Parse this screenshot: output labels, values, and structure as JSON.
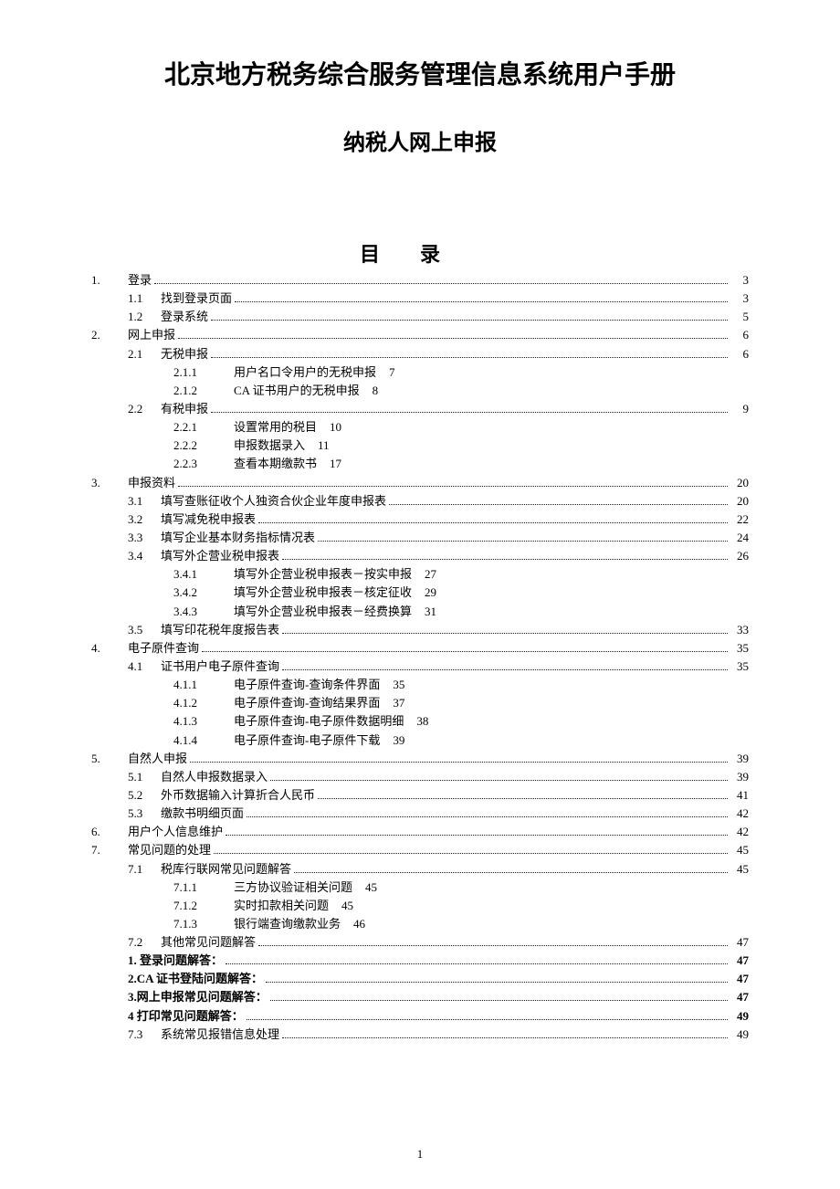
{
  "title": "北京地方税务综合服务管理信息系统用户手册",
  "subtitle": "纳税人网上申报",
  "toc_heading": "目录",
  "page_number": "1",
  "entries": [
    {
      "l": "l1",
      "num": "1.",
      "label": "登录",
      "page": "3",
      "dots": true
    },
    {
      "l": "l2",
      "num": "1.1",
      "label": "找到登录页面",
      "page": "3",
      "dots": true
    },
    {
      "l": "l2",
      "num": "1.2",
      "label": "登录系统",
      "page": "5",
      "dots": true
    },
    {
      "l": "l1",
      "num": "2.",
      "label": "网上申报",
      "page": "6",
      "dots": true
    },
    {
      "l": "l2",
      "num": "2.1",
      "label": "无税申报",
      "page": "6",
      "dots": true
    },
    {
      "l": "l3",
      "num": "2.1.1",
      "label": "用户名口令用户的无税申报",
      "page": "7",
      "dots": false
    },
    {
      "l": "l3",
      "num": "2.1.2",
      "label": "CA 证书用户的无税申报",
      "page": "8",
      "dots": false
    },
    {
      "l": "l2",
      "num": "2.2",
      "label": "有税申报",
      "page": "9",
      "dots": true
    },
    {
      "l": "l3",
      "num": "2.2.1",
      "label": "设置常用的税目",
      "page": "10",
      "dots": false
    },
    {
      "l": "l3",
      "num": "2.2.2",
      "label": "申报数据录入",
      "page": "11",
      "dots": false
    },
    {
      "l": "l3",
      "num": "2.2.3",
      "label": "查看本期缴款书",
      "page": "17",
      "dots": false
    },
    {
      "l": "l1",
      "num": "3.",
      "label": "申报资料",
      "page": "20",
      "dots": true
    },
    {
      "l": "l2",
      "num": "3.1",
      "label": "填写查账征收个人独资合伙企业年度申报表",
      "page": "20",
      "dots": true
    },
    {
      "l": "l2",
      "num": "3.2",
      "label": "填写减免税申报表",
      "page": "22",
      "dots": true
    },
    {
      "l": "l2",
      "num": "3.3",
      "label": "填写企业基本财务指标情况表",
      "page": "24",
      "dots": true
    },
    {
      "l": "l2",
      "num": "3.4",
      "label": "填写外企营业税申报表",
      "page": "26",
      "dots": true
    },
    {
      "l": "l3",
      "num": "3.4.1",
      "label": "填写外企营业税申报表－按实申报",
      "page": "27",
      "dots": false
    },
    {
      "l": "l3",
      "num": "3.4.2",
      "label": "填写外企营业税申报表－核定征收",
      "page": "29",
      "dots": false
    },
    {
      "l": "l3",
      "num": "3.4.3",
      "label": "填写外企营业税申报表－经费换算",
      "page": "31",
      "dots": false
    },
    {
      "l": "l2",
      "num": "3.5",
      "label": "填写印花税年度报告表",
      "page": "33",
      "dots": true
    },
    {
      "l": "l1",
      "num": "4.",
      "label": "电子原件查询",
      "page": "35",
      "dots": true
    },
    {
      "l": "l2",
      "num": "4.1",
      "label": "证书用户电子原件查询",
      "page": "35",
      "dots": true
    },
    {
      "l": "l3",
      "num": "4.1.1",
      "label": "电子原件查询-查询条件界面",
      "page": "35",
      "dots": false
    },
    {
      "l": "l3",
      "num": "4.1.2",
      "label": "电子原件查询-查询结果界面",
      "page": "37",
      "dots": false
    },
    {
      "l": "l3",
      "num": "4.1.3",
      "label": "电子原件查询-电子原件数据明细",
      "page": "38",
      "dots": false
    },
    {
      "l": "l3",
      "num": "4.1.4",
      "label": "电子原件查询-电子原件下载",
      "page": "39",
      "dots": false
    },
    {
      "l": "l1",
      "num": "5.",
      "label": "自然人申报",
      "page": "39",
      "dots": true
    },
    {
      "l": "l2",
      "num": "5.1",
      "label": "自然人申报数据录入",
      "page": "39",
      "dots": true
    },
    {
      "l": "l2",
      "num": "5.2",
      "label": "外币数据输入计算折合人民币",
      "page": "41",
      "dots": true
    },
    {
      "l": "l2",
      "num": "5.3",
      "label": "缴款书明细页面",
      "page": "42",
      "dots": true
    },
    {
      "l": "l1",
      "num": "6.",
      "label": "用户个人信息维护",
      "page": "42",
      "dots": true
    },
    {
      "l": "l1",
      "num": "7.",
      "label": "常见问题的处理",
      "page": "45",
      "dots": true
    },
    {
      "l": "l2",
      "num": "7.1",
      "label": "税库行联网常见问题解答",
      "page": "45",
      "dots": true
    },
    {
      "l": "l3",
      "num": "7.1.1",
      "label": "三方协议验证相关问题",
      "page": "45",
      "dots": false
    },
    {
      "l": "l3",
      "num": "7.1.2",
      "label": "实时扣款相关问题",
      "page": "45",
      "dots": false
    },
    {
      "l": "l3",
      "num": "7.1.3",
      "label": "银行端查询缴款业务",
      "page": "46",
      "dots": false
    },
    {
      "l": "l2",
      "num": "7.2",
      "label": "其他常见问题解答",
      "page": "47",
      "dots": true
    },
    {
      "l": "l2b",
      "num": "",
      "label": "1. 登录问题解答：",
      "page": "47",
      "dots": true
    },
    {
      "l": "l2b",
      "num": "",
      "label": "2.CA 证书登陆问题解答：",
      "page": "47",
      "dots": true
    },
    {
      "l": "l2b",
      "num": "",
      "label": "3.网上申报常见问题解答：",
      "page": "47",
      "dots": true
    },
    {
      "l": "l2b",
      "num": "",
      "label": "4 打印常见问题解答：",
      "page": "49",
      "dots": true
    },
    {
      "l": "l2",
      "num": "7.3",
      "label": "系统常见报错信息处理",
      "page": "49",
      "dots": true
    }
  ]
}
